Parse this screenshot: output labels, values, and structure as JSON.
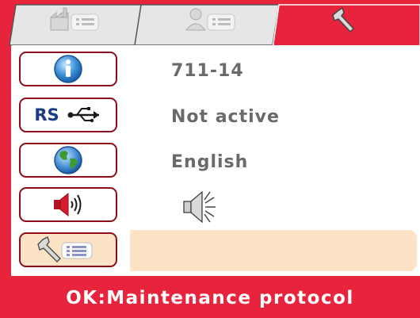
{
  "tabs": [
    {
      "name": "machine",
      "icon": "factory-list-icon",
      "active": false
    },
    {
      "name": "user",
      "icon": "user-list-icon",
      "active": false
    },
    {
      "name": "service",
      "icon": "wrench-icon",
      "active": true
    }
  ],
  "rows": [
    {
      "icon": "info-icon",
      "value": "711-14"
    },
    {
      "icon": "rs-usb-icon",
      "icon_label": "RS",
      "value": "Not active"
    },
    {
      "icon": "globe-icon",
      "value": "English"
    },
    {
      "icon": "speaker-icon",
      "value_icon": "speaker-volume-icon"
    },
    {
      "icon": "wrench-list-icon",
      "selected": true
    }
  ],
  "status": {
    "text": "OK:Maintenance protocol"
  },
  "colors": {
    "accent": "#e8243d",
    "border": "#8e0d1d",
    "tab_inactive": "#e6e6e6",
    "highlight": "#fce3c5",
    "value_text": "#6a6a6a"
  }
}
